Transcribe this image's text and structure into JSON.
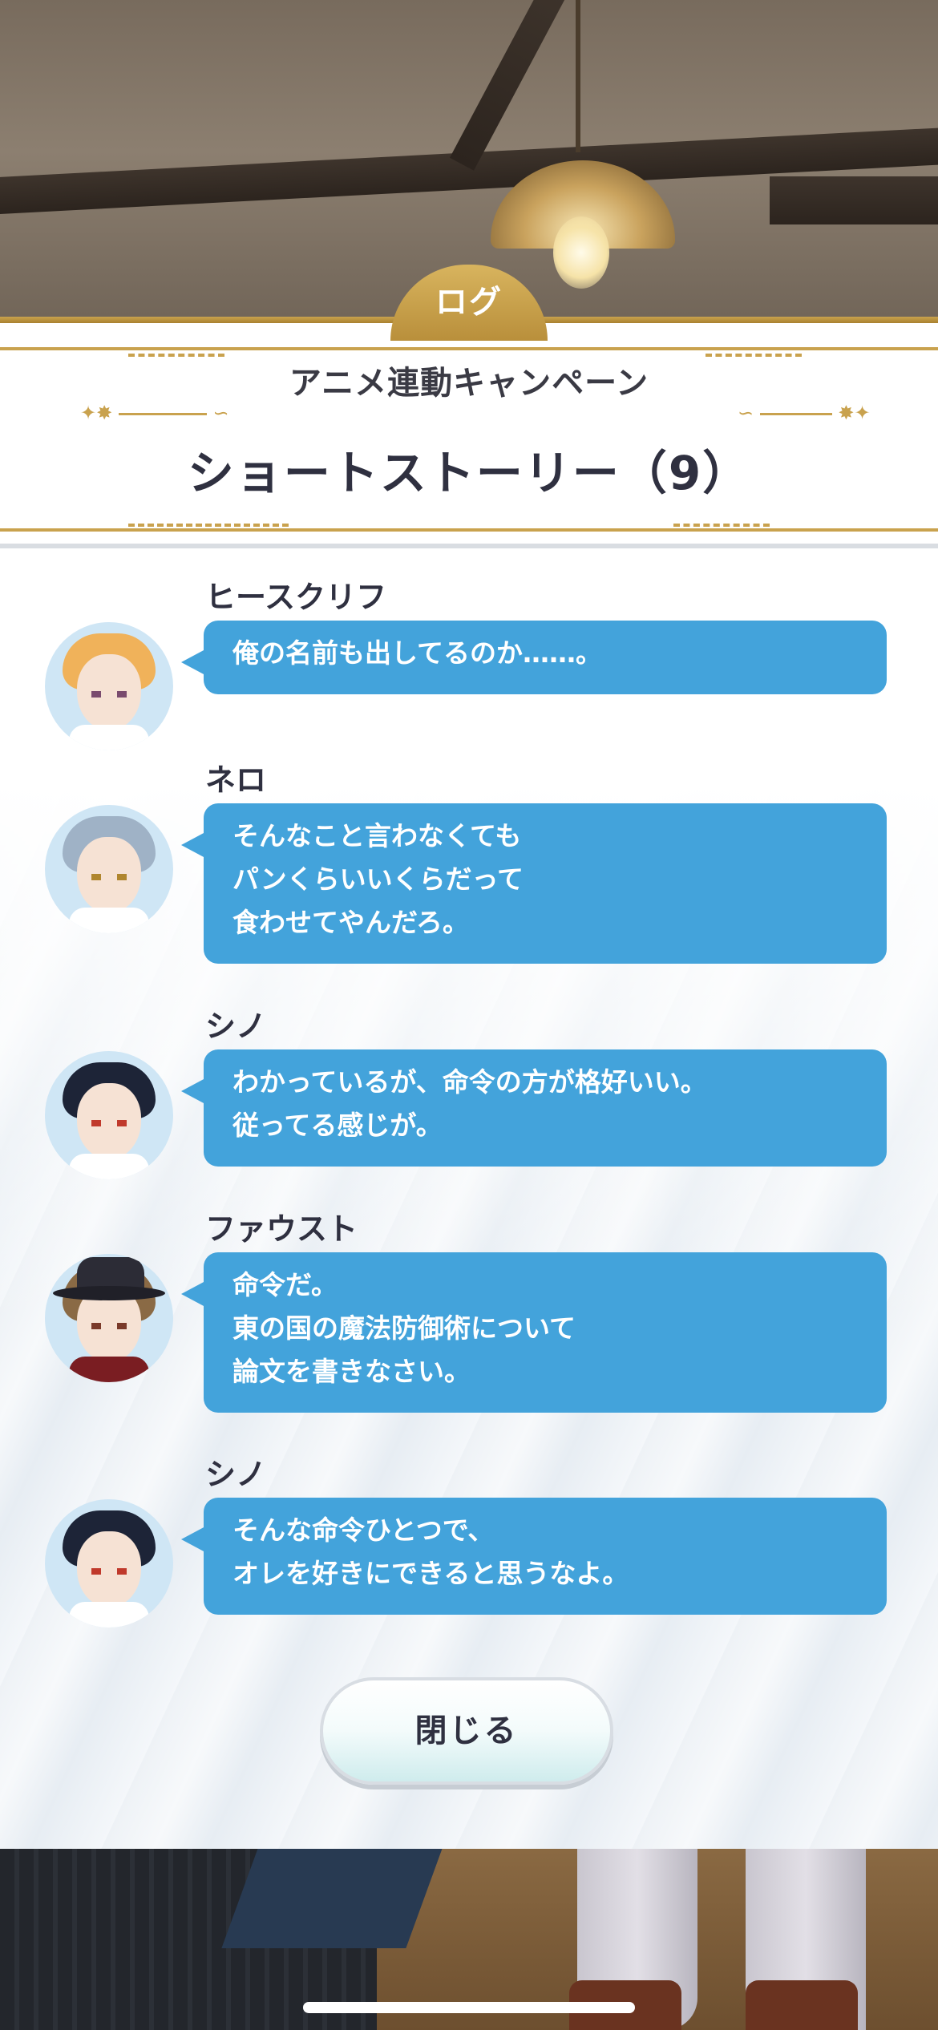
{
  "tab_label": "ログ",
  "header": {
    "subtitle": "アニメ連動キャンペーン",
    "title": "ショートストーリー（9）"
  },
  "entries": [
    {
      "speaker": "ヒースクリフ",
      "text": "俺の名前も出してるのか……。",
      "hair": "#f0b25a"
    },
    {
      "speaker": "ネロ",
      "text": "そんなこと言わなくても\nパンくらいいくらだって\n食わせてやんだろ。",
      "hair": "#9fb2c6"
    },
    {
      "speaker": "シノ",
      "text": "わかっているが、命令の方が格好いい。\n従ってる感じが。",
      "hair": "#1d2437"
    },
    {
      "speaker": "ファウスト",
      "text": "命令だ。\n東の国の魔法防御術について\n論文を書きなさい。",
      "hair": "#8a6a45"
    },
    {
      "speaker": "シノ",
      "text": "そんな命令ひとつで、\nオレを好きにできると思うなよ。",
      "hair": "#1d2437"
    }
  ],
  "close_button": "閉じる",
  "colors": {
    "accent_gold": "#c9a24e",
    "bubble_blue": "#43a3db",
    "text_dark": "#2f3040"
  }
}
